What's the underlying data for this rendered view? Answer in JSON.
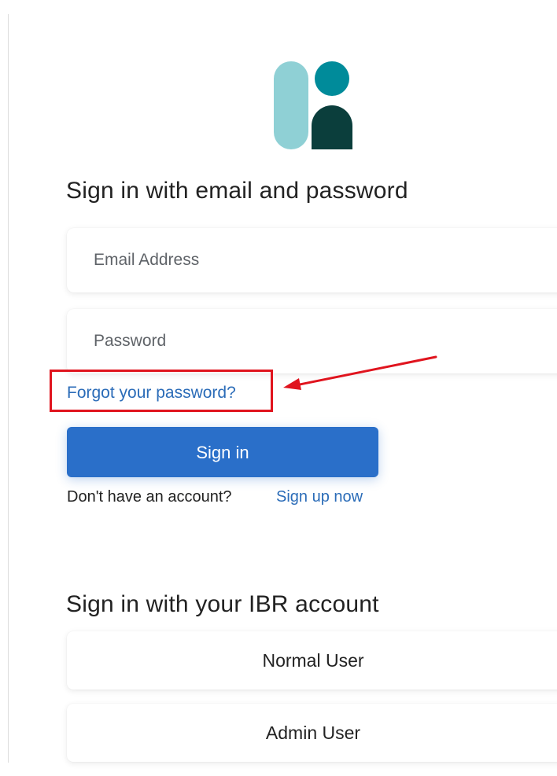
{
  "logo": {
    "colors": {
      "light_teal": "#8fd0d5",
      "teal": "#008b9a",
      "dark_teal": "#0b3e3c"
    }
  },
  "email_section": {
    "heading": "Sign in with email and password",
    "email_placeholder": "Email Address",
    "password_placeholder": "Password",
    "forgot_link": "Forgot your password?",
    "sign_in_button": "Sign in",
    "no_account_text": "Don't have an account?",
    "sign_up_link": "Sign up now"
  },
  "account_section": {
    "heading": "Sign in with your IBR account",
    "normal_user_button": "Normal User",
    "admin_user_button": "Admin User"
  },
  "annotation": {
    "highlight_color": "#e0141e"
  },
  "colors": {
    "primary": "#2a6fc9",
    "link": "#2b6cb8"
  }
}
